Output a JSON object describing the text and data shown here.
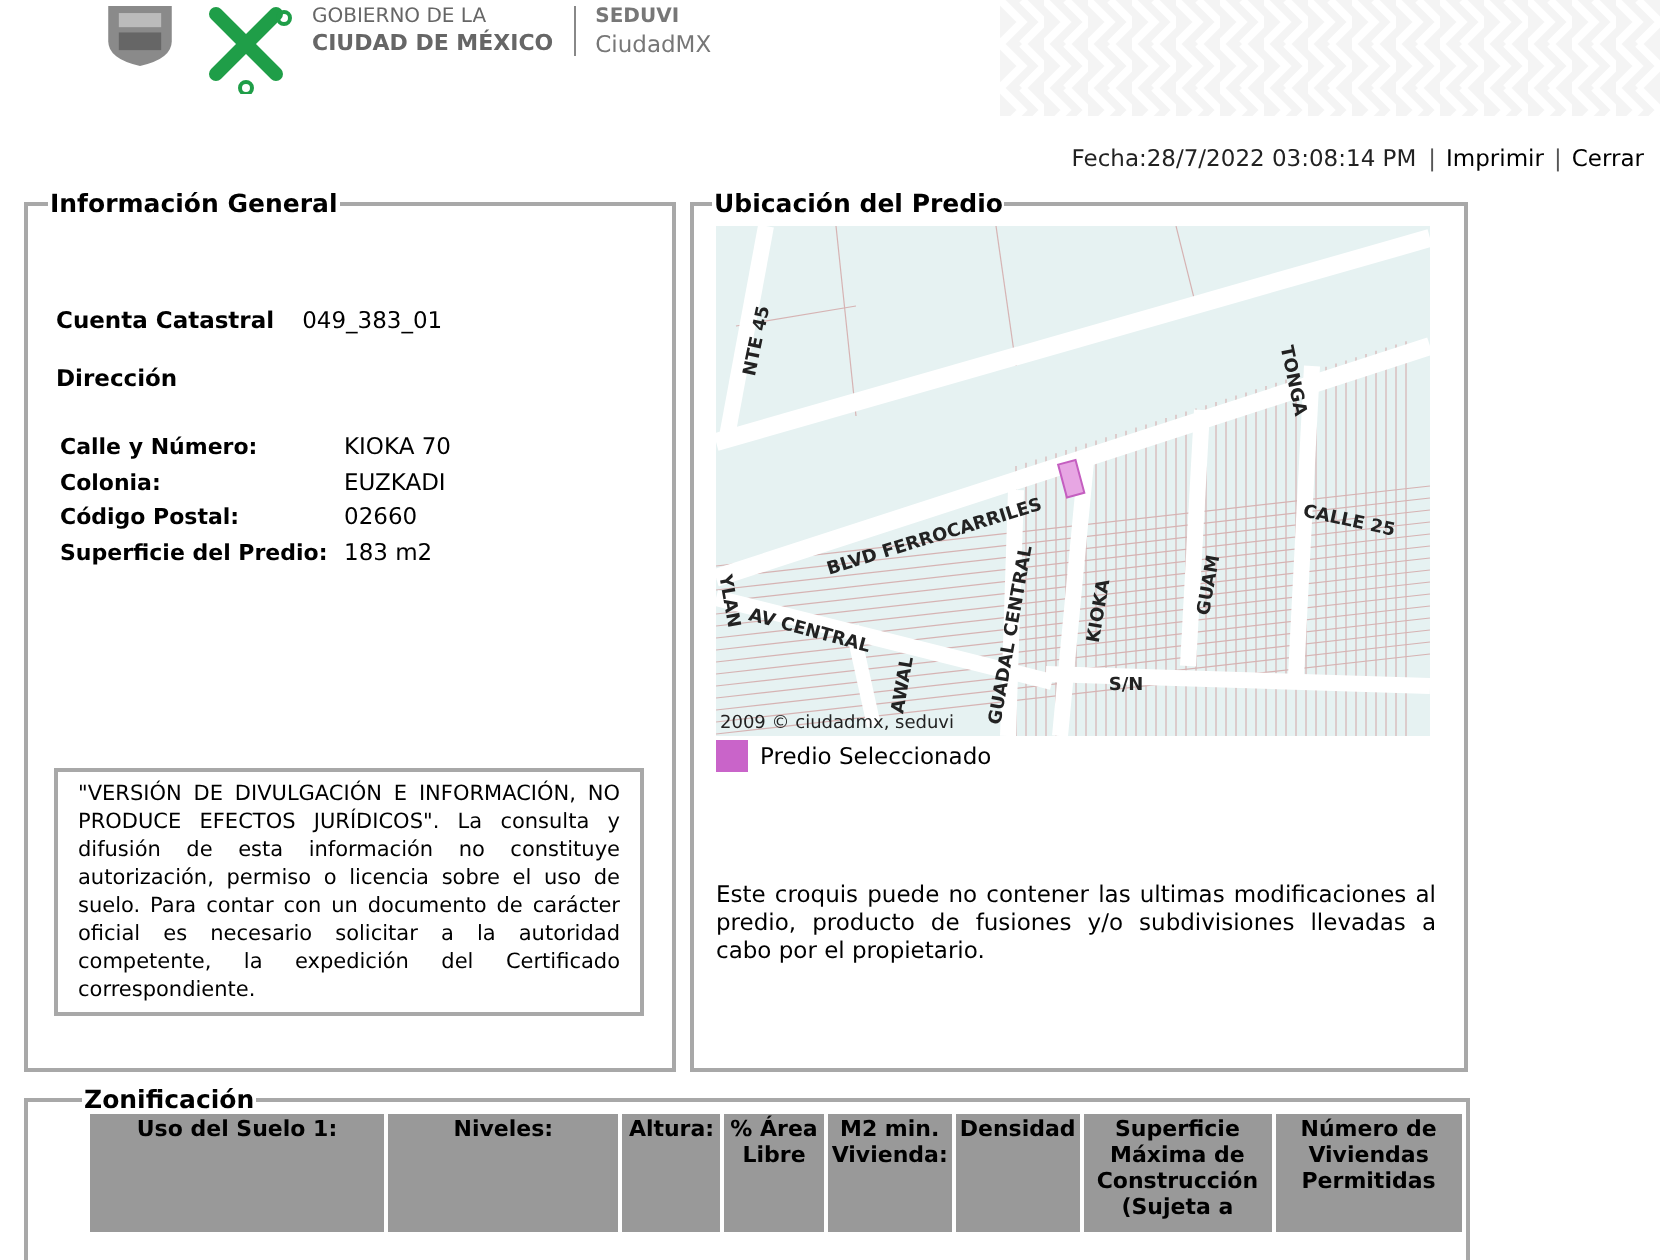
{
  "header": {
    "gov_lines": [
      "GOBIERNO DE LA",
      "CIUDAD DE MÉXICO"
    ],
    "agency": "SEDUVI",
    "agency_sub": "CiudadMX"
  },
  "toolbar": [
    {
      "kind": "text",
      "text": "Fecha:28/7/2022 03:08:14 PM"
    },
    {
      "kind": "sep",
      "text": "|"
    },
    {
      "kind": "link",
      "text": "Imprimir"
    },
    {
      "kind": "sep",
      "text": "|"
    },
    {
      "kind": "link",
      "text": "Cerrar"
    }
  ],
  "info": {
    "title": "Información General",
    "account": {
      "label": "Cuenta Catastral",
      "value": "049_383_01"
    },
    "address_title": "Dirección",
    "fields": [
      {
        "label": "Calle y Número:",
        "value": "KIOKA 70"
      },
      {
        "label": "Colonia:",
        "value": "EUZKADI"
      },
      {
        "label": "Código Postal:",
        "value": "02660"
      },
      {
        "label": "Superficie del Predio:",
        "value": "183 m2"
      }
    ],
    "disclaimer": "\"VERSIÓN DE DIVULGACIÓN E INFORMACIÓN, NO PRODUCE EFECTOS JURÍDICOS\". La consulta y difusión de esta información no constituye autorización, permiso o licencia sobre el uso de suelo. Para contar con un documento de carácter oficial es necesario solicitar a la autoridad competente, la expedición del Certificado correspondiente."
  },
  "location": {
    "title": "Ubicación del Predio",
    "map": {
      "street_labels": [
        "NTE 45",
        "TONGA",
        "BLVD FERROCARRILES",
        "CALLE 25",
        "GUADAL CENTRAL",
        "KIOKA",
        "GUAM",
        "AV CENTRAL",
        "S/N",
        "AWAL",
        "YLAN"
      ],
      "credit": "2009 © ciudadmx, seduvi"
    },
    "legend": "Predio Seleccionado",
    "note": "Este croquis puede no contener las ultimas modificaciones al predio, producto de fusiones y/o subdivisiones llevadas a cabo por el propietario."
  },
  "zoning": {
    "title": "Zonificación",
    "columns": [
      "Uso del Suelo 1:",
      "Niveles:",
      "Altura:",
      "% Área Libre",
      "M2 min. Vivienda:",
      "Densidad",
      "Superficie Máxima de Construcción (Sujeta a",
      "Número de Viviendas Permitidas"
    ]
  }
}
